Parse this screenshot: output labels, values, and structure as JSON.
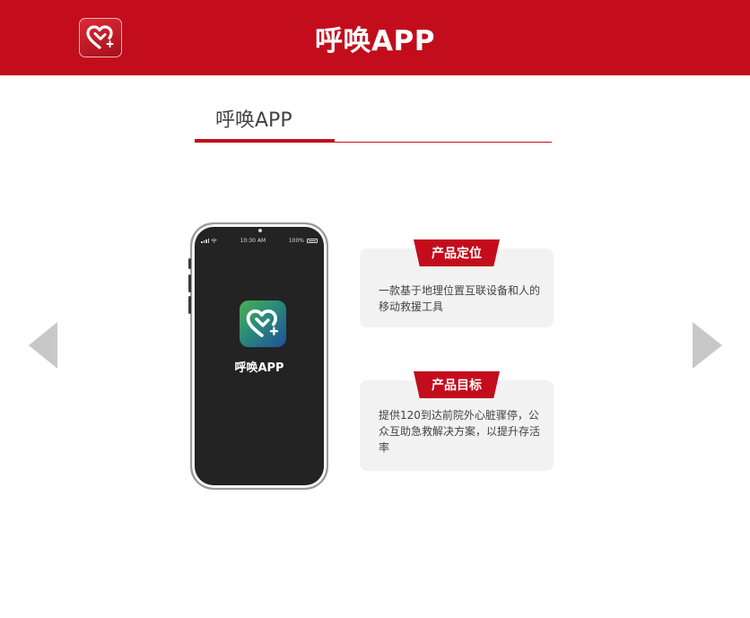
{
  "header": {
    "title": "呼唤APP",
    "logo_icon": "heart-plus-icon",
    "background": "#c30d1c"
  },
  "section": {
    "title": "呼唤APP",
    "accent": "#c30d1c"
  },
  "navigation": {
    "prev_icon": "triangle-left-icon",
    "next_icon": "triangle-right-icon",
    "arrow_color": "#c8c8c8"
  },
  "phone": {
    "time": "10:30 AM",
    "battery": "100%",
    "battery_level": 1.0,
    "app_icon": "heart-plus-icon",
    "app_name": "呼唤APP"
  },
  "cards": [
    {
      "tag": "产品定位",
      "text": "一款基于地理位置互联设备和人的移动救援工具"
    },
    {
      "tag": "产品目标",
      "text": "提供120到达前院外心脏骤停，公众互助急救解决方案，以提升存活率"
    }
  ]
}
